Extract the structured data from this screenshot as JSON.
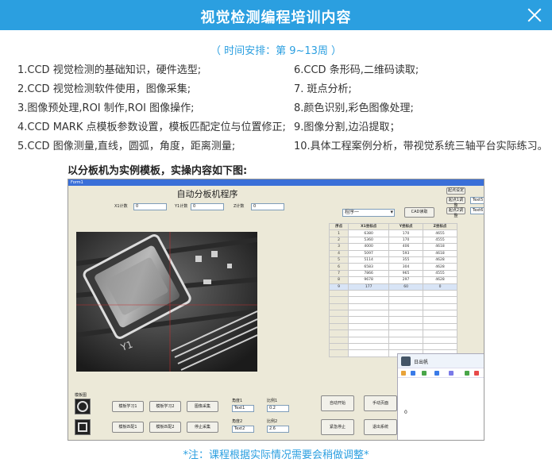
{
  "header": {
    "title": "视觉检测编程培训内容",
    "close_label": "×"
  },
  "schedule": "（ 时间安排：第 9~13周 ）",
  "topics_left": [
    "1.CCD 视觉检测的基础知识，硬件选型;",
    "2.CCD 视觉检测软件使用，图像采集;",
    "3.图像预处理,ROI 制作,ROI 图像操作;",
    "4.CCD MARK 点模板参数设置，模板匹配定位与位置修正;",
    "5.CCD 图像测量,直线，圆弧，角度，距离测量;"
  ],
  "topics_right": [
    "6.CCD 条形码,二维码读取;",
    "7. 斑点分析;",
    "8.颜色识别,彩色图像处理;",
    "9.图像分割,边沿提取；",
    "10.具体工程案例分析，带视觉系统三轴平台实际练习。"
  ],
  "subheading": "以分板机为实例模板，实操内容如下图:",
  "app": {
    "window_title": "Form1",
    "title": "自动分板机程序",
    "fields": [
      {
        "label": "X1计数",
        "value": "0"
      },
      {
        "label": "Y1计数",
        "value": "0"
      },
      {
        "label": "Z计数",
        "value": "0"
      }
    ],
    "side_buttons": [
      "起点设定",
      "起点1调整",
      "起点2调整"
    ],
    "side_inputs": [
      "Text5",
      "Text6"
    ],
    "combo_value": "程序一",
    "cad_button": "CAD读取",
    "table": {
      "headers": [
        "序点",
        "X1坐标点",
        "Y坐标点",
        "Z坐标点"
      ],
      "rows": [
        [
          "1",
          "6380",
          "170",
          "4655"
        ],
        [
          "2",
          "5360",
          "170",
          "4555"
        ],
        [
          "3",
          "4000",
          "406",
          "4618"
        ],
        [
          "4",
          "5097",
          "593",
          "4618"
        ],
        [
          "5",
          "5114",
          "355",
          "4628"
        ],
        [
          "6",
          "6583",
          "304",
          "4628"
        ],
        [
          "7",
          "7866",
          "965",
          "4555"
        ],
        [
          "8",
          "9678",
          "297",
          "4628"
        ],
        [
          "9",
          "177",
          "60",
          "0"
        ]
      ]
    },
    "template_label": "模板图",
    "template_buttons": [
      "模板学习1",
      "模板学习2",
      "图像采集",
      "模板匹配1",
      "模板匹配2",
      "停止采集"
    ],
    "param_inputs": [
      {
        "label": "角度1",
        "value": "Text1"
      },
      {
        "label": "比例1",
        "value": "0.2"
      },
      {
        "label": "角度2",
        "value": "Text2"
      },
      {
        "label": "比例2",
        "value": "2.6"
      }
    ],
    "action_buttons": [
      "自动开始",
      "手动页面",
      "紧急停止",
      "退出系统"
    ],
    "chat": {
      "name": "日出帆",
      "value": "0"
    }
  },
  "note": "*注：课程根据实际情况需要会稍做调整*",
  "colors": {
    "accent": "#2b9fe0",
    "app_bg": "#ece9d8"
  }
}
